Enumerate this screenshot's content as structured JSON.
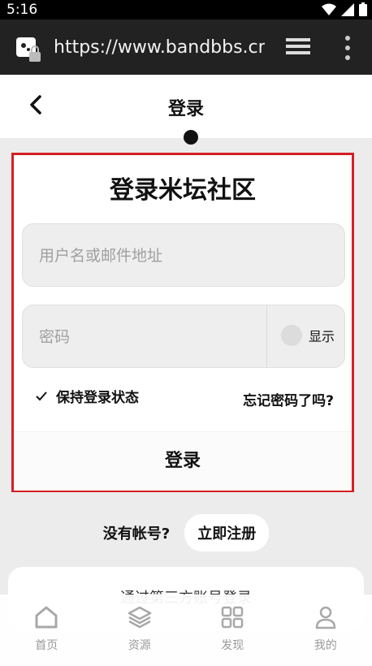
{
  "status_bar": {
    "time": "5:16"
  },
  "browser": {
    "url": "https://www.bandbbs.cn/"
  },
  "header": {
    "title": "登录"
  },
  "login_card": {
    "heading": "登录米坛社区",
    "username_placeholder": "用户名或邮件地址",
    "password_placeholder": "密码",
    "show_label": "显示",
    "remember_label": "保持登录状态",
    "forgot_label": "忘记密码了吗?",
    "submit_label": "登录"
  },
  "signup": {
    "question": "没有帐号?",
    "button": "立即注册"
  },
  "third_party": {
    "text": "通过第三方账号登录"
  },
  "bottom_nav": {
    "items": [
      {
        "label": "首页",
        "icon": "home-icon"
      },
      {
        "label": "资源",
        "icon": "layers-icon"
      },
      {
        "label": "发现",
        "icon": "grid-icon"
      },
      {
        "label": "我的",
        "icon": "user-icon"
      }
    ]
  },
  "colors": {
    "highlight": "#d32026",
    "nav_gray": "#9a9a9a"
  }
}
